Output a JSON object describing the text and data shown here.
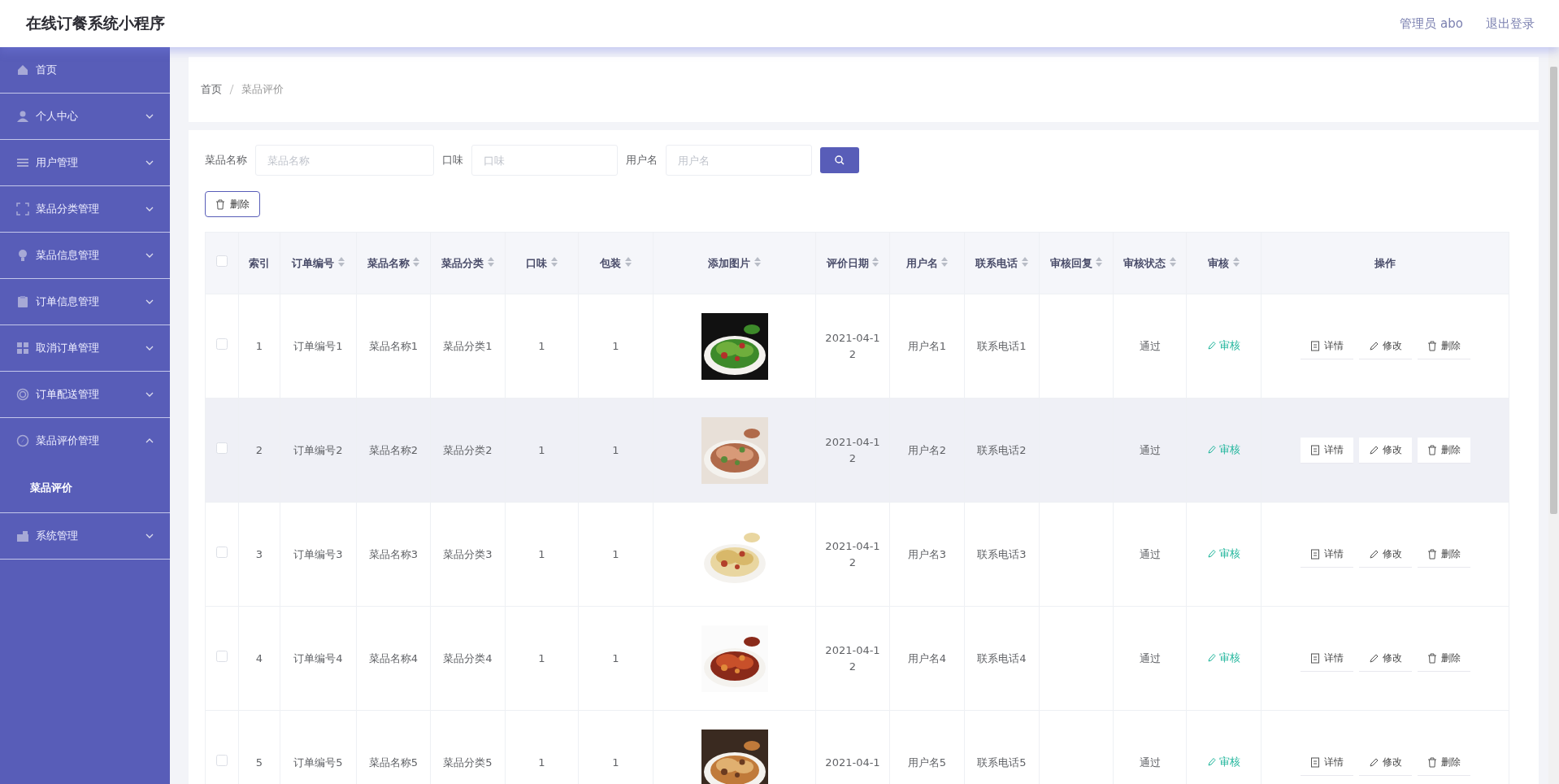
{
  "header": {
    "title": "在线订餐系统小程序",
    "user": "管理员 abo",
    "logout": "退出登录"
  },
  "sidebar": {
    "items": [
      {
        "label": "首页",
        "kind": "link"
      },
      {
        "label": "个人中心",
        "kind": "submenu",
        "expanded": false
      },
      {
        "label": "用户管理",
        "kind": "submenu",
        "expanded": false
      },
      {
        "label": "菜品分类管理",
        "kind": "submenu",
        "expanded": false
      },
      {
        "label": "菜品信息管理",
        "kind": "submenu",
        "expanded": false
      },
      {
        "label": "订单信息管理",
        "kind": "submenu",
        "expanded": false
      },
      {
        "label": "取消订单管理",
        "kind": "submenu",
        "expanded": false
      },
      {
        "label": "订单配送管理",
        "kind": "submenu",
        "expanded": false
      },
      {
        "label": "菜品评价管理",
        "kind": "submenu",
        "expanded": true,
        "children": [
          {
            "label": "菜品评价",
            "selected": true
          }
        ]
      },
      {
        "label": "系统管理",
        "kind": "submenu",
        "expanded": false
      }
    ]
  },
  "breadcrumb": [
    "首页",
    "菜品评价"
  ],
  "search": {
    "fields": [
      {
        "label": "菜品名称",
        "placeholder": "菜品名称"
      },
      {
        "label": "口味",
        "placeholder": "口味"
      },
      {
        "label": "用户名",
        "placeholder": "用户名"
      }
    ]
  },
  "toolbar": {
    "delete": "删除"
  },
  "table": {
    "columns": [
      {
        "kind": "checkbox",
        "checked": false
      },
      {
        "kind": "text",
        "label": "索引",
        "sortable": false
      },
      {
        "kind": "text",
        "label": "订单编号",
        "sortable": true
      },
      {
        "kind": "text",
        "label": "菜品名称",
        "sortable": true
      },
      {
        "kind": "text",
        "label": "菜品分类",
        "sortable": true
      },
      {
        "kind": "text",
        "label": "口味",
        "sortable": true
      },
      {
        "kind": "text",
        "label": "包装",
        "sortable": true
      },
      {
        "label": "添加图片",
        "sortable": true
      },
      {
        "kind": "text",
        "label": "评价日期",
        "sortable": true
      },
      {
        "kind": "text",
        "label": "用户名",
        "sortable": true
      },
      {
        "kind": "text",
        "label": "联系电话",
        "sortable": true
      },
      {
        "kind": "text",
        "label": "审核回复",
        "sortable": true
      },
      {
        "kind": "text",
        "label": "审核状态",
        "sortable": true
      },
      {
        "kind": "audit",
        "label": "审核",
        "sortable": true
      },
      {
        "kind": "actions",
        "label": "操作",
        "sortable": false
      }
    ],
    "rows": [
      {
        "hovered": false,
        "cells": [
          {
            "checked": false
          },
          "1",
          "订单编号1",
          "菜品名称1",
          "菜品分类1",
          "1",
          "1",
          {
            "kind": "picture"
          },
          "2021-04-12",
          "用户名1",
          "联系电话1",
          "",
          "通过",
          "审核",
          [
            "详情",
            "修改",
            "删除"
          ]
        ]
      },
      {
        "hovered": true,
        "cells": [
          {
            "checked": false
          },
          "2",
          "订单编号2",
          "菜品名称2",
          "菜品分类2",
          "1",
          "1",
          {
            "kind": "picture"
          },
          "2021-04-12",
          "用户名2",
          "联系电话2",
          "",
          "通过",
          "审核",
          [
            "详情",
            "修改",
            "删除"
          ]
        ]
      },
      {
        "hovered": false,
        "cells": [
          {
            "checked": false
          },
          "3",
          "订单编号3",
          "菜品名称3",
          "菜品分类3",
          "1",
          "1",
          {
            "kind": "picture"
          },
          "2021-04-12",
          "用户名3",
          "联系电话3",
          "",
          "通过",
          "审核",
          [
            "详情",
            "修改",
            "删除"
          ]
        ]
      },
      {
        "hovered": false,
        "cells": [
          {
            "checked": false
          },
          "4",
          "订单编号4",
          "菜品名称4",
          "菜品分类4",
          "1",
          "1",
          {
            "kind": "picture"
          },
          "2021-04-12",
          "用户名4",
          "联系电话4",
          "",
          "通过",
          "审核",
          [
            "详情",
            "修改",
            "删除"
          ]
        ]
      },
      {
        "hovered": false,
        "cells": [
          {
            "checked": false
          },
          "5",
          "订单编号5",
          "菜品名称5",
          "菜品分类5",
          "1",
          "1",
          {
            "kind": "picture"
          },
          "2021-04-1",
          "用户名5",
          "联系电话5",
          "",
          "通过",
          "审核",
          [
            "详情",
            "修改",
            "删除"
          ]
        ]
      }
    ]
  }
}
